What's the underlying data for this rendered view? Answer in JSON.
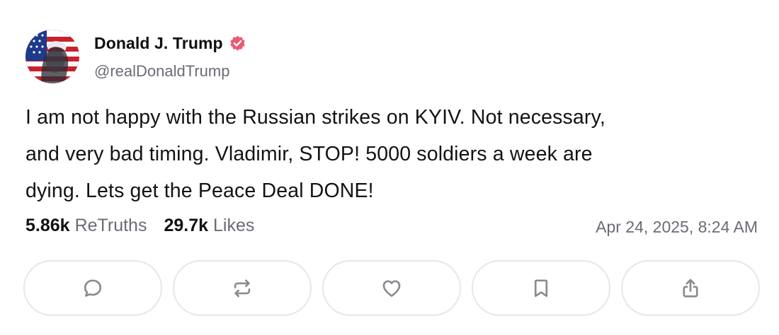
{
  "author": {
    "display_name": "Donald J. Trump",
    "handle": "@realDonaldTrump",
    "verified_icon": "verified-badge-icon",
    "badge_color": "#e95b75"
  },
  "post": {
    "lines": [
      "I am not happy with the Russian strikes on KYIV. Not necessary,",
      "and very bad timing. Vladimir, STOP! 5000 soldiers a week are",
      "dying. Lets get the Peace Deal DONE!"
    ]
  },
  "stats": {
    "retruths_count": "5.86k",
    "retruths_label": "ReTruths",
    "likes_count": "29.7k",
    "likes_label": "Likes"
  },
  "timestamp": "Apr 24, 2025, 8:24 AM",
  "actions": [
    {
      "name": "reply",
      "icon": "comment-icon"
    },
    {
      "name": "retruth",
      "icon": "repost-icon"
    },
    {
      "name": "like",
      "icon": "heart-icon"
    },
    {
      "name": "bookmark",
      "icon": "bookmark-icon"
    },
    {
      "name": "share",
      "icon": "share-icon"
    }
  ],
  "colors": {
    "icon_gray": "#8b8b93",
    "muted_text": "#6b6b76",
    "button_border": "#e6e6ea"
  }
}
